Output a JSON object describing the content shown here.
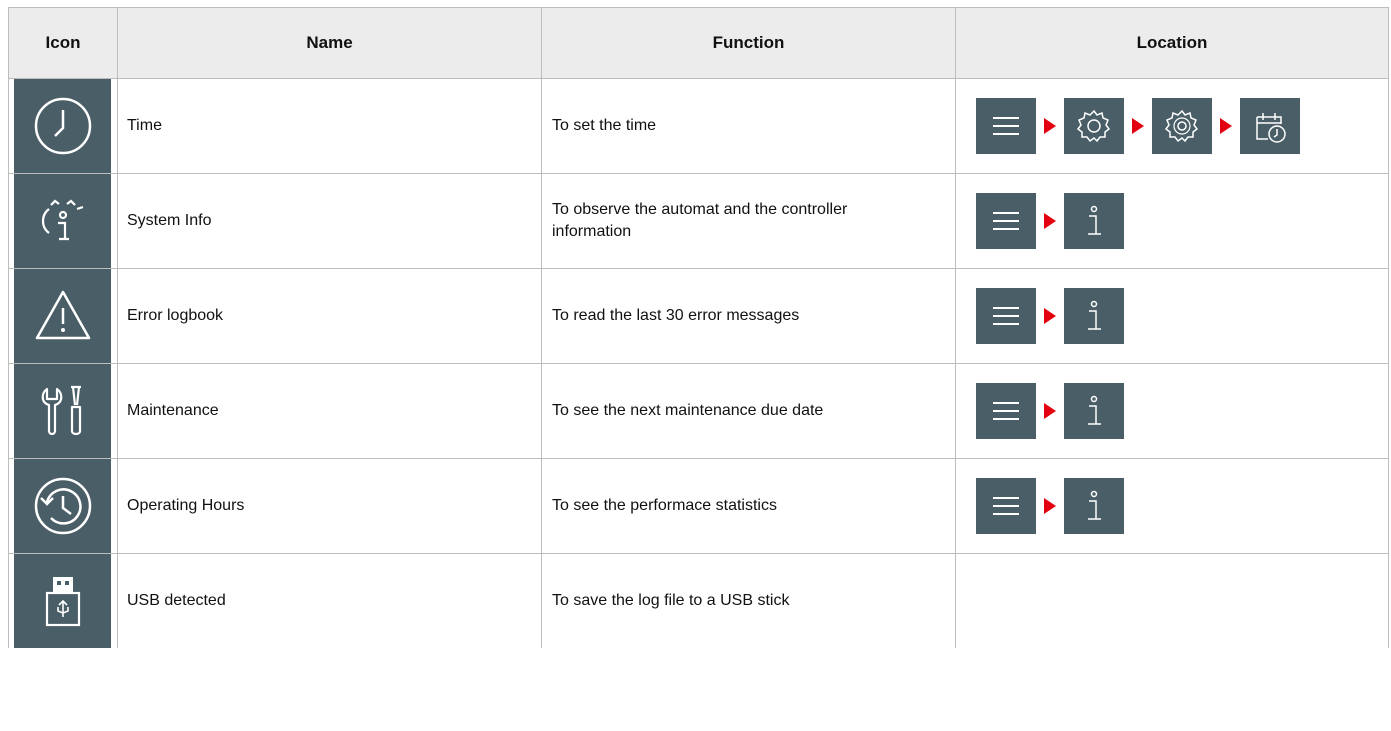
{
  "table": {
    "headers": {
      "icon": "Icon",
      "name": "Name",
      "function": "Function",
      "location": "Location"
    },
    "rows": [
      {
        "icon": "clock-icon",
        "name": "Time",
        "function": "To set the time",
        "location": [
          "menu-icon",
          "gear-icon",
          "gears-icon",
          "calendar-clock-icon"
        ]
      },
      {
        "icon": "system-info-icon",
        "name": "System Info",
        "function": "To observe the automat and the controller information",
        "location": [
          "menu-icon",
          "info-icon"
        ]
      },
      {
        "icon": "warning-icon",
        "name": "Error logbook",
        "function": "To read the last 30 error messages",
        "location": [
          "menu-icon",
          "info-icon"
        ]
      },
      {
        "icon": "tools-icon",
        "name": "Maintenance",
        "function": "To see the next maintenance due date",
        "location": [
          "menu-icon",
          "info-icon"
        ]
      },
      {
        "icon": "history-icon",
        "name": "Operating Hours",
        "function": "To see the performace statistics",
        "location": [
          "menu-icon",
          "info-icon"
        ]
      },
      {
        "icon": "usb-stick-icon",
        "name": "USB detected",
        "function": "To save the log file to a USB stick",
        "location": []
      }
    ]
  },
  "colors": {
    "icon_bg": "#4a5e67",
    "arrow": "#e3000f",
    "header_bg": "#ececec",
    "border": "#bdbdbd"
  }
}
